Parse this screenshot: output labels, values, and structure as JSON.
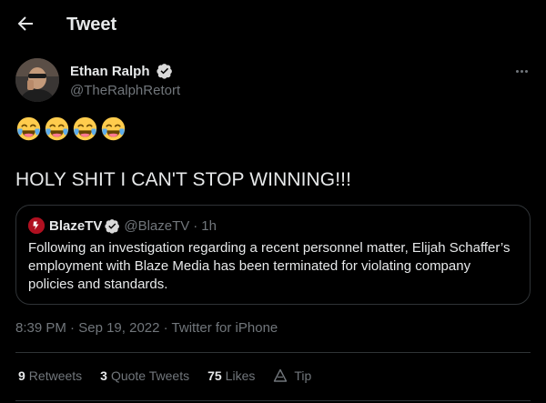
{
  "header": {
    "title": "Tweet",
    "back_icon": "arrow-left-icon"
  },
  "author": {
    "name": "Ethan Ralph",
    "handle": "@TheRalphRetort",
    "verified_icon": "verified-badge-icon"
  },
  "tweet": {
    "emojis": [
      "😂",
      "😂",
      "😂",
      "😂"
    ],
    "text": "HOLY SHIT I CAN'T STOP WINNING!!!"
  },
  "quote": {
    "name": "BlazeTV",
    "handle": "@BlazeTV",
    "separator": "·",
    "time": "1h",
    "text": "Following an investigation regarding a recent personnel matter, Elijah Schaffer’s employment with Blaze Media has been terminated for violating company policies and standards."
  },
  "meta": {
    "time": "8:39 PM",
    "separator": "·",
    "date": "Sep 19, 2022",
    "source": "Twitter for iPhone"
  },
  "stats": {
    "retweets": {
      "count": "9",
      "label": "Retweets"
    },
    "quotes": {
      "count": "3",
      "label": "Quote Tweets"
    },
    "likes": {
      "count": "75",
      "label": "Likes"
    },
    "tip": {
      "label": "Tip"
    }
  },
  "colors": {
    "background": "#000000",
    "text": "#e7e9ea",
    "secondary": "#71767b",
    "border": "#2f3336",
    "verified": "#d9d9d9"
  }
}
